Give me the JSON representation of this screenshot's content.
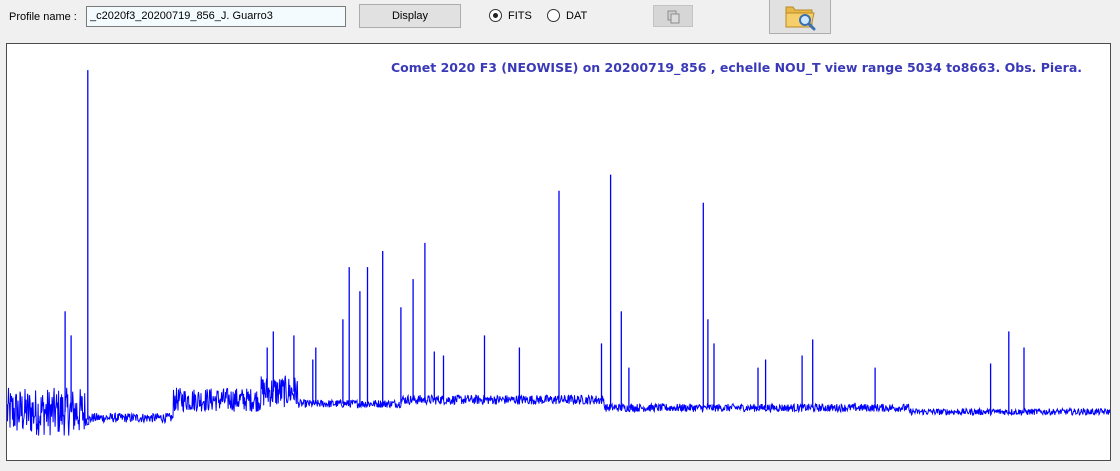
{
  "toolbar": {
    "profile_label": "Profile name :",
    "profile_value": "_c2020f3_20200719_856_J. Guarro3",
    "display_label": "Display",
    "format_options": [
      {
        "label": "FITS",
        "selected": true
      },
      {
        "label": "DAT",
        "selected": false
      }
    ],
    "copy_icon": "copy-icon",
    "open_icon": "folder-search-icon"
  },
  "chart_data": {
    "type": "line",
    "title": "Comet 2020 F3 (NEOWISE) on 20200719_856 , echelle NOU_T view range 5034 to8663. Obs. Piera.",
    "xlabel": "",
    "ylabel": "",
    "xlim": [
      5034,
      8663
    ],
    "ylim": [
      0,
      1
    ],
    "grid": false,
    "line_color": "#0000ff",
    "baseline_segments": [
      {
        "x": [
          5034,
          5290
        ],
        "y": 0.11,
        "noise": 0.06
      },
      {
        "x": [
          5290,
          5310
        ],
        "y": 0.09,
        "noise": 0.015
      },
      {
        "x": [
          5310,
          5580
        ],
        "y": 0.095,
        "noise": 0.012
      },
      {
        "x": [
          5580,
          5870
        ],
        "y": 0.14,
        "noise": 0.03
      },
      {
        "x": [
          5870,
          5990
        ],
        "y": 0.16,
        "noise": 0.04
      },
      {
        "x": [
          5990,
          6330
        ],
        "y": 0.13,
        "noise": 0.01
      },
      {
        "x": [
          6330,
          7000
        ],
        "y": 0.14,
        "noise": 0.012
      },
      {
        "x": [
          7000,
          8000
        ],
        "y": 0.12,
        "noise": 0.01
      },
      {
        "x": [
          8000,
          8663
        ],
        "y": 0.11,
        "noise": 0.008
      }
    ],
    "peaks": [
      {
        "x": 5225,
        "y": 0.36
      },
      {
        "x": 5245,
        "y": 0.3
      },
      {
        "x": 5300,
        "y": 0.96
      },
      {
        "x": 5890,
        "y": 0.27
      },
      {
        "x": 5910,
        "y": 0.31
      },
      {
        "x": 5978,
        "y": 0.3
      },
      {
        "x": 6040,
        "y": 0.24
      },
      {
        "x": 6050,
        "y": 0.27
      },
      {
        "x": 6139,
        "y": 0.34
      },
      {
        "x": 6160,
        "y": 0.47
      },
      {
        "x": 6195,
        "y": 0.41
      },
      {
        "x": 6220,
        "y": 0.47
      },
      {
        "x": 6270,
        "y": 0.51
      },
      {
        "x": 6330,
        "y": 0.37
      },
      {
        "x": 6370,
        "y": 0.44
      },
      {
        "x": 6409,
        "y": 0.53
      },
      {
        "x": 6440,
        "y": 0.26
      },
      {
        "x": 6470,
        "y": 0.25
      },
      {
        "x": 6605,
        "y": 0.3
      },
      {
        "x": 6720,
        "y": 0.27
      },
      {
        "x": 6850,
        "y": 0.66
      },
      {
        "x": 6990,
        "y": 0.28
      },
      {
        "x": 7020,
        "y": 0.7
      },
      {
        "x": 7055,
        "y": 0.36
      },
      {
        "x": 7080,
        "y": 0.22
      },
      {
        "x": 7325,
        "y": 0.63
      },
      {
        "x": 7340,
        "y": 0.34
      },
      {
        "x": 7360,
        "y": 0.28
      },
      {
        "x": 7505,
        "y": 0.22
      },
      {
        "x": 7530,
        "y": 0.24
      },
      {
        "x": 7650,
        "y": 0.25
      },
      {
        "x": 7685,
        "y": 0.29
      },
      {
        "x": 7890,
        "y": 0.22
      },
      {
        "x": 8270,
        "y": 0.23
      },
      {
        "x": 8330,
        "y": 0.31
      },
      {
        "x": 8380,
        "y": 0.27
      }
    ]
  }
}
